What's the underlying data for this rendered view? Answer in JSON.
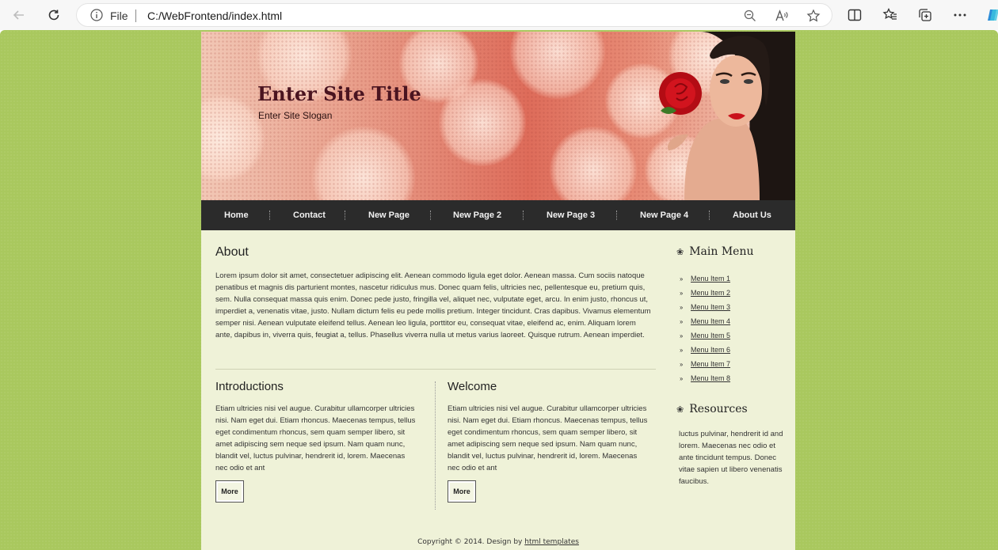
{
  "browser": {
    "file_label": "File",
    "url": "C:/WebFrontend/index.html"
  },
  "site": {
    "title": "Enter Site Title",
    "slogan": "Enter Site Slogan"
  },
  "nav": {
    "items": [
      "Home",
      "Contact",
      "New Page",
      "New Page 2",
      "New Page 3",
      "New Page 4",
      "About Us"
    ]
  },
  "about": {
    "heading": "About",
    "text": "Lorem ipsum dolor sit amet, consectetuer adipiscing elit. Aenean commodo ligula eget dolor. Aenean massa. Cum sociis natoque penatibus et magnis dis parturient montes, nascetur ridiculus mus. Donec quam felis, ultricies nec, pellentesque eu, pretium quis, sem. Nulla consequat massa quis enim. Donec pede justo, fringilla vel, aliquet nec, vulputate eget, arcu. In enim justo, rhoncus ut, imperdiet a, venenatis vitae, justo. Nullam dictum felis eu pede mollis pretium. Integer tincidunt. Cras dapibus. Vivamus elementum semper nisi. Aenean vulputate eleifend tellus. Aenean leo ligula, porttitor eu, consequat vitae, eleifend ac, enim. Aliquam lorem ante, dapibus in, viverra quis, feugiat a, tellus. Phasellus viverra nulla ut metus varius laoreet. Quisque rutrum. Aenean imperdiet."
  },
  "introductions": {
    "heading": "Introductions",
    "text": "Etiam ultricies nisi vel augue. Curabitur ullamcorper ultricies nisi. Nam eget dui. Etiam rhoncus. Maecenas tempus, tellus eget condimentum rhoncus, sem quam semper libero, sit amet adipiscing sem neque sed ipsum. Nam quam nunc, blandit vel, luctus pulvinar, hendrerit id, lorem. Maecenas nec odio et ant",
    "button": "More"
  },
  "welcome": {
    "heading": "Welcome",
    "text": "Etiam ultricies nisi vel augue. Curabitur ullamcorper ultricies nisi. Nam eget dui. Etiam rhoncus. Maecenas tempus, tellus eget condimentum rhoncus, sem quam semper libero, sit amet adipiscing sem neque sed ipsum. Nam quam nunc, blandit vel, luctus pulvinar, hendrerit id, lorem. Maecenas nec odio et ant",
    "button": "More"
  },
  "sidebar": {
    "menu_heading": "Main Menu",
    "menu_items": [
      "Menu Item 1",
      "Menu Item 2",
      "Menu Item 3",
      "Menu Item 4",
      "Menu Item 5",
      "Menu Item 6",
      "Menu Item 7",
      "Menu Item 8"
    ],
    "resources_heading": "Resources",
    "resources_text": "luctus pulvinar, hendrerit id and lorem. Maecenas nec odio et ante tincidunt tempus. Donec vitae sapien ut libero venenatis faucibus."
  },
  "footer": {
    "text": "Copyright © 2014. Design by",
    "link": "html templates"
  },
  "colors": {
    "page_bg": "#a9c85e",
    "content_bg": "#eff2d8",
    "nav_bg": "#2b2b2b",
    "title_color": "#4a1420"
  }
}
